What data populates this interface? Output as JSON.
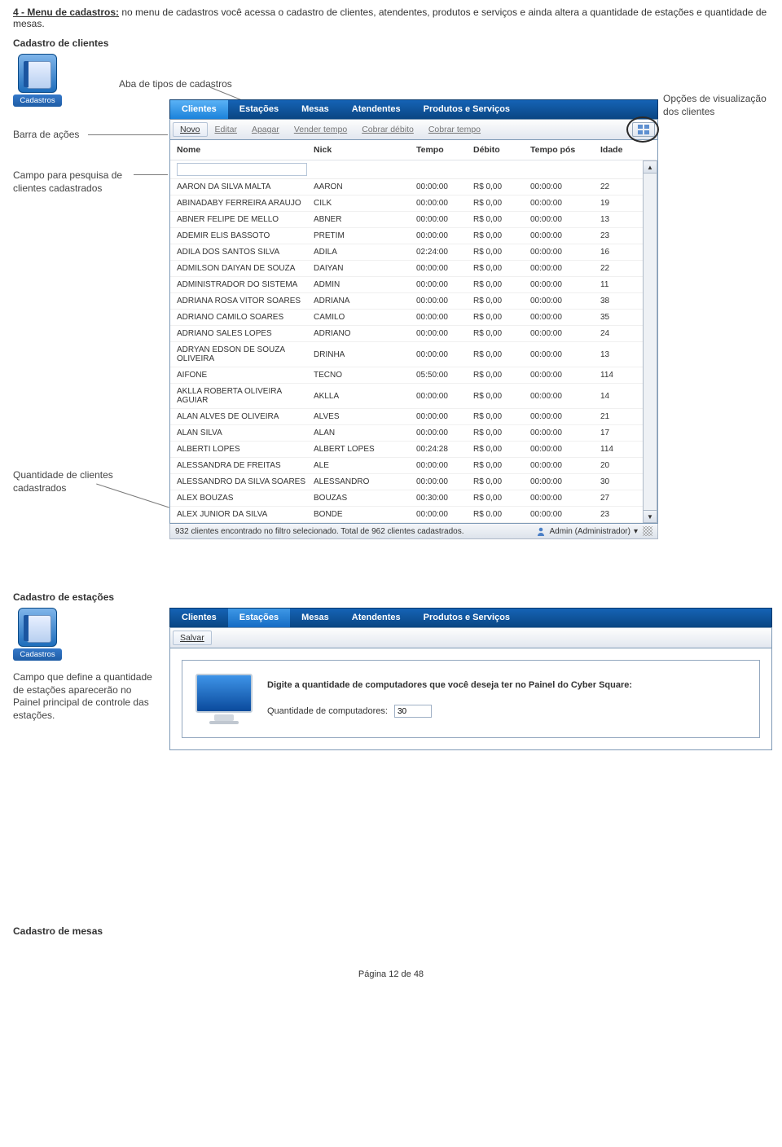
{
  "page": {
    "title_prefix": "4 - Menu de cadastros:",
    "title_rest": " no menu de cadastros você acessa o cadastro de clientes, atendentes, produtos e serviços e ainda altera a quantidade de estações e quantidade de mesas.",
    "footer": "Página 12 de 48"
  },
  "sections": {
    "clientes": "Cadastro de clientes",
    "estacoes": "Cadastro de estações",
    "mesas": "Cadastro de mesas"
  },
  "cadastros_label": "Cadastros",
  "annotations": {
    "aba": "Aba de tipos de cadastros",
    "barra": "Barra de ações",
    "pesquisa": "Campo para pesquisa de clientes cadastrados",
    "qtd": "Quantidade de clientes cadastrados",
    "opcoes": "Opções de visualização dos clientes",
    "estacoes_left": "Campo que define a quantidade de estações aparecerão no Painel principal de controle das estações."
  },
  "tabs": [
    "Clientes",
    "Estações",
    "Mesas",
    "Atendentes",
    "Produtos e Serviços"
  ],
  "toolbar": {
    "novo": "Novo",
    "editar": "Editar",
    "apagar": "Apagar",
    "vender": "Vender tempo",
    "cobrard": "Cobrar débito",
    "cobrart": "Cobrar tempo"
  },
  "toolbar2": {
    "salvar": "Salvar"
  },
  "columns": {
    "nome": "Nome",
    "nick": "Nick",
    "tempo": "Tempo",
    "debito": "Débito",
    "tempopos": "Tempo pós",
    "idade": "Idade"
  },
  "rows": [
    {
      "nome": "AARON DA SILVA MALTA",
      "nick": "AARON",
      "tempo": "00:00:00",
      "debito": "R$ 0,00",
      "tpos": "00:00:00",
      "idade": "22"
    },
    {
      "nome": "ABINADABY FERREIRA ARAUJO",
      "nick": "CILK",
      "tempo": "00:00:00",
      "debito": "R$ 0,00",
      "tpos": "00:00:00",
      "idade": "19"
    },
    {
      "nome": "ABNER FELIPE DE MELLO",
      "nick": "ABNER",
      "tempo": "00:00:00",
      "debito": "R$ 0,00",
      "tpos": "00:00:00",
      "idade": "13"
    },
    {
      "nome": "ADEMIR ELIS BASSOTO",
      "nick": "PRETIM",
      "tempo": "00:00:00",
      "debito": "R$ 0,00",
      "tpos": "00:00:00",
      "idade": "23"
    },
    {
      "nome": "ADILA DOS SANTOS SILVA",
      "nick": "ADILA",
      "tempo": "02:24:00",
      "debito": "R$ 0,00",
      "tpos": "00:00:00",
      "idade": "16"
    },
    {
      "nome": "ADMILSON DAIYAN DE SOUZA",
      "nick": "DAIYAN",
      "tempo": "00:00:00",
      "debito": "R$ 0,00",
      "tpos": "00:00:00",
      "idade": "22"
    },
    {
      "nome": "ADMINISTRADOR DO SISTEMA",
      "nick": "ADMIN",
      "tempo": "00:00:00",
      "debito": "R$ 0,00",
      "tpos": "00:00:00",
      "idade": "11"
    },
    {
      "nome": "ADRIANA ROSA VITOR SOARES",
      "nick": "ADRIANA",
      "tempo": "00:00:00",
      "debito": "R$ 0,00",
      "tpos": "00:00:00",
      "idade": "38"
    },
    {
      "nome": "ADRIANO CAMILO SOARES",
      "nick": "CAMILO",
      "tempo": "00:00:00",
      "debito": "R$ 0,00",
      "tpos": "00:00:00",
      "idade": "35"
    },
    {
      "nome": "ADRIANO SALES LOPES",
      "nick": "ADRIANO",
      "tempo": "00:00:00",
      "debito": "R$ 0,00",
      "tpos": "00:00:00",
      "idade": "24"
    },
    {
      "nome": "ADRYAN EDSON DE SOUZA OLIVEIRA",
      "nick": "DRINHA",
      "tempo": "00:00:00",
      "debito": "R$ 0,00",
      "tpos": "00:00:00",
      "idade": "13"
    },
    {
      "nome": "AIFONE",
      "nick": "TECNO",
      "tempo": "05:50:00",
      "debito": "R$ 0,00",
      "tpos": "00:00:00",
      "idade": "114"
    },
    {
      "nome": "AKLLA ROBERTA OLIVEIRA AGUIAR",
      "nick": "AKLLA",
      "tempo": "00:00:00",
      "debito": "R$ 0,00",
      "tpos": "00:00:00",
      "idade": "14"
    },
    {
      "nome": "ALAN ALVES DE OLIVEIRA",
      "nick": "ALVES",
      "tempo": "00:00:00",
      "debito": "R$ 0,00",
      "tpos": "00:00:00",
      "idade": "21"
    },
    {
      "nome": "ALAN SILVA",
      "nick": "ALAN",
      "tempo": "00:00:00",
      "debito": "R$ 0,00",
      "tpos": "00:00:00",
      "idade": "17"
    },
    {
      "nome": "ALBERTI LOPES",
      "nick": "ALBERT LOPES",
      "tempo": "00:24:28",
      "debito": "R$ 0,00",
      "tpos": "00:00:00",
      "idade": "114"
    },
    {
      "nome": "ALESSANDRA DE FREITAS",
      "nick": "ALE",
      "tempo": "00:00:00",
      "debito": "R$ 0,00",
      "tpos": "00:00:00",
      "idade": "20"
    },
    {
      "nome": "ALESSANDRO DA SILVA SOARES",
      "nick": "ALESSANDRO",
      "tempo": "00:00:00",
      "debito": "R$ 0,00",
      "tpos": "00:00:00",
      "idade": "30"
    },
    {
      "nome": "ALEX BOUZAS",
      "nick": "BOUZAS",
      "tempo": "00:30:00",
      "debito": "R$ 0,00",
      "tpos": "00:00:00",
      "idade": "27"
    },
    {
      "nome": "ALEX JUNIOR DA SILVA",
      "nick": "BONDE",
      "tempo": "00:00:00",
      "debito": "R$ 0.00",
      "tpos": "00:00:00",
      "idade": "23"
    }
  ],
  "status": {
    "left": "932 clientes encontrado no filtro selecionado. Total de 962 clientes cadastrados.",
    "user": "Admin (Administrador)"
  },
  "estacoes": {
    "title": "Digite a quantidade de computadores que você deseja ter no Painel do Cyber Square:",
    "label": "Quantidade de computadores:",
    "value": "30"
  }
}
